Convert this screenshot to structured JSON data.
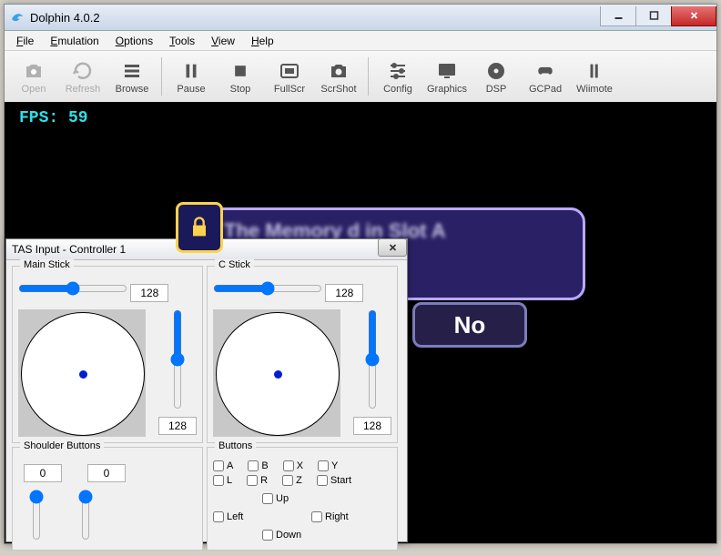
{
  "app": {
    "title": "Dolphin 4.0.2"
  },
  "menubar": [
    "File",
    "Emulation",
    "Options",
    "Tools",
    "View",
    "Help"
  ],
  "toolbar": {
    "open": "Open",
    "refresh": "Refresh",
    "browse": "Browse",
    "pause": "Pause",
    "stop": "Stop",
    "fullscr": "FullScr",
    "scrshot": "ScrShot",
    "config": "Config",
    "graphics": "Graphics",
    "dsp": "DSP",
    "gcpad": "GCPad",
    "wiimote": "Wiimote"
  },
  "viewport": {
    "fps": "FPS: 59",
    "game_dialog": {
      "lines": "The Memory     d in Slot A\n                 ame Data.\n                      a?",
      "no_label": "No"
    }
  },
  "tas": {
    "title": "TAS Input - Controller 1",
    "main_stick": {
      "label": "Main Stick",
      "x": "128",
      "y": "128"
    },
    "c_stick": {
      "label": "C Stick",
      "x": "128",
      "y": "128"
    },
    "shoulder": {
      "label": "Shoulder Buttons",
      "l": "0",
      "r": "0"
    },
    "buttons": {
      "label": "Buttons",
      "A": "A",
      "B": "B",
      "X": "X",
      "Y": "Y",
      "L": "L",
      "R": "R",
      "Z": "Z",
      "Start": "Start",
      "Up": "Up",
      "Down": "Down",
      "Left": "Left",
      "Right": "Right"
    }
  }
}
